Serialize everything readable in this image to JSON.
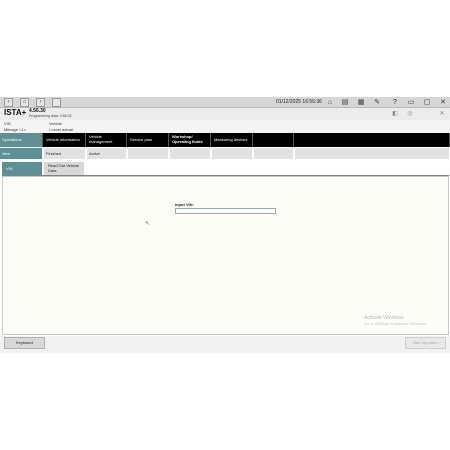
{
  "toolbar": {
    "back": "‹",
    "home": "⌂",
    "forward": "›",
    "datetime": "01/12/2025 16:56:36",
    "icons": [
      "home-icon",
      "stats-icon",
      "news-icon",
      "lib-icon",
      "wrench-icon",
      "help-icon",
      "print-icon",
      "min-icon",
      "window-icon",
      "close-icon"
    ]
  },
  "header": {
    "app_name": "ISTA+",
    "version": "4.56.30",
    "programming_label": "Programming data:",
    "programming_version": "4.56.33"
  },
  "vehicle": {
    "vin_label": "VIN",
    "mileage_label": "Mileage",
    "mileage_value": "<1>",
    "vehicle_label": "Vehicle",
    "level_label": "I-Level actual"
  },
  "nav": {
    "operations": "Operations",
    "vehicle_information": "Vehicle information",
    "vehicle_management": "Vehicle management",
    "service_plan": "Service plan",
    "workshop": "Workshop/ Operating fluids",
    "measuring_devices": "Measuring devices"
  },
  "subnav": {
    "new": "New",
    "finished": "Finished",
    "active": "Active"
  },
  "tabs": {
    "vin": "VIN",
    "read_out": "Read Out Vehicle Data"
  },
  "form": {
    "input_vin_label": "Input VIN:",
    "input_vin_value": ""
  },
  "watermark": {
    "title": "Activate Windows",
    "subtitle": "Go to Settings to activate Windows."
  },
  "buttons": {
    "keyboard": "Keyboard",
    "start_operation": "Start operation"
  },
  "colors": {
    "accent": "#5d8f94",
    "nav_bg": "#000000"
  }
}
